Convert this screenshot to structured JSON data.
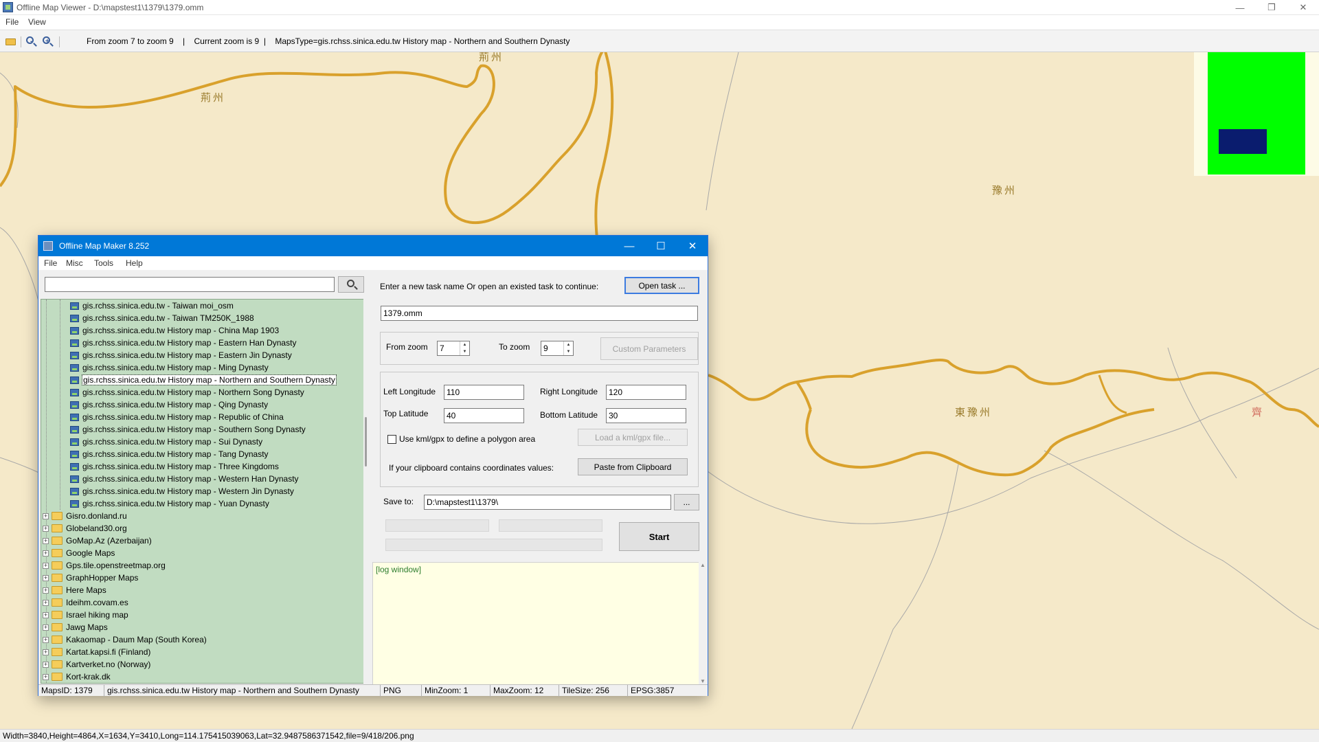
{
  "viewer": {
    "title": "Offline Map Viewer - D:\\mapstest1\\1379\\1379.omm",
    "menu": [
      "File",
      "View"
    ],
    "toolbar_status": "From zoom 7 to zoom 9    |    Current zoom is 9  |    MapsType=gis.rchss.sinica.edu.tw History map - Northern and Southern Dynasty",
    "status_bar": "Width=3840,Height=4864,X=1634,Y=3410,Long=114.175415039063,Lat=32.9487586371542,file=9/418/206.png",
    "controls": {
      "minimize": "—",
      "maximize": "❐",
      "close": "✕"
    }
  },
  "map": {
    "labels": [
      "荊州",
      "荊州",
      "豫州",
      "東豫州",
      "齊"
    ],
    "colors": {
      "background": "#f5e9c9",
      "border": "#d9a12c"
    }
  },
  "dialog": {
    "title": "Offline Map Maker 8.252",
    "menu": [
      "File",
      "Misc",
      "Tools",
      "Help"
    ],
    "controls": {
      "minimize": "—",
      "maximize": "☐",
      "close": "✕"
    },
    "search": {
      "value": "",
      "placeholder": ""
    },
    "tree": {
      "children": [
        "gis.rchss.sinica.edu.tw - Taiwan moi_osm",
        "gis.rchss.sinica.edu.tw - Taiwan TM250K_1988",
        "gis.rchss.sinica.edu.tw History map - China Map 1903",
        "gis.rchss.sinica.edu.tw History map - Eastern Han Dynasty",
        "gis.rchss.sinica.edu.tw History map - Eastern Jin Dynasty",
        "gis.rchss.sinica.edu.tw History map - Ming Dynasty",
        "gis.rchss.sinica.edu.tw History map - Northern and Southern Dynasty",
        "gis.rchss.sinica.edu.tw History map - Northern Song Dynasty",
        "gis.rchss.sinica.edu.tw History map - Qing Dynasty",
        "gis.rchss.sinica.edu.tw History map - Republic of China",
        "gis.rchss.sinica.edu.tw History map - Southern Song Dynasty",
        "gis.rchss.sinica.edu.tw History map - Sui Dynasty",
        "gis.rchss.sinica.edu.tw History map - Tang Dynasty",
        "gis.rchss.sinica.edu.tw History map - Three Kingdoms",
        "gis.rchss.sinica.edu.tw History map - Western Han Dynasty",
        "gis.rchss.sinica.edu.tw History map - Western Jin Dynasty",
        "gis.rchss.sinica.edu.tw History map - Yuan Dynasty"
      ],
      "folders": [
        "Gisro.donland.ru",
        "Globeland30.org",
        "GoMap.Az (Azerbaijan)",
        "Google Maps",
        "Gps.tile.openstreetmap.org",
        "GraphHopper Maps",
        "Here Maps",
        "Ideihm.covam.es",
        "Israel hiking map",
        "Jawg Maps",
        "Kakaomap - Daum Map (South Korea)",
        "Kartat.kapsi.fi (Finland)",
        "Kartverket.no (Norway)",
        "Kort-krak.dk"
      ],
      "selected": "gis.rchss.sinica.edu.tw History map - Northern and Southern Dynasty"
    },
    "task_label": "Enter a new task name Or open an existed task to continue:",
    "open_task": "Open task ...",
    "task_name": "1379.omm",
    "from_zoom_label": "From zoom",
    "from_zoom": "7",
    "to_zoom_label": "To zoom",
    "to_zoom": "9",
    "custom_params": "Custom Parameters",
    "left_lon_label": "Left Longitude",
    "left_lon": "110",
    "right_lon_label": "Right Longitude",
    "right_lon": "120",
    "top_lat_label": "Top Latitude",
    "top_lat": "40",
    "bottom_lat_label": "Bottom Latitude",
    "bottom_lat": "30",
    "kml_label": "Use kml/gpx to define a polygon area",
    "kml_button": "Load a kml/gpx file...",
    "clipboard_label": "If your clipboard contains coordinates values:",
    "clipboard_button": "Paste from Clipboard",
    "save_label": "Save to:",
    "save_path": "D:\\mapstest1\\1379\\",
    "browse": "...",
    "start": "Start",
    "log": "[log window]",
    "status": {
      "maps_id": "MapsID: 1379",
      "maps_name": "gis.rchss.sinica.edu.tw History map - Northern and Southern Dynasty",
      "format": "PNG",
      "min_zoom": "MinZoom: 1",
      "max_zoom": "MaxZoom: 12",
      "tile_size": "TileSize: 256",
      "epsg": "EPSG:3857"
    }
  }
}
